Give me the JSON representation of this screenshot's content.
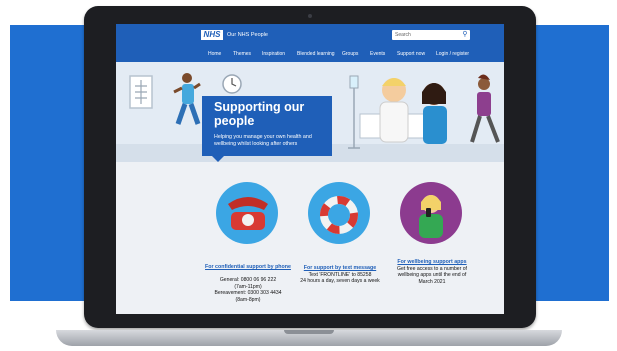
{
  "header": {
    "logo": "NHS",
    "site_title": "Our NHS People",
    "search_placeholder": "Search"
  },
  "nav": [
    "Home",
    "Themes",
    "Inspiration",
    "Blended learning",
    "Groups",
    "Events",
    "Support now",
    "Login / register"
  ],
  "hero": {
    "title": "Supporting our people",
    "subtitle": "Helping you manage your own health and wellbeing whilst looking after others"
  },
  "cards": [
    {
      "icon": "telephone-icon",
      "link": "For confidential support by phone",
      "lines": [
        "General: 0800 06 96 222",
        "(7am-11pm)",
        "Bereavement: 0300 303 4434",
        "(8am-8pm)"
      ]
    },
    {
      "icon": "lifebuoy-icon",
      "link": "For support by text message",
      "lines": [
        "Text 'FRONTLINE' to 85258",
        "24 hours a day, seven days a week"
      ]
    },
    {
      "icon": "phone-user-icon",
      "link": "For wellbeing support apps",
      "lines": [
        "Get free access to a number of",
        "wellbeing apps until the end of",
        "March 2021"
      ]
    }
  ],
  "colors": {
    "brand_blue": "#1f5fb8",
    "background_blue": "#1f6fd1",
    "content_bg": "#eef1f5"
  }
}
